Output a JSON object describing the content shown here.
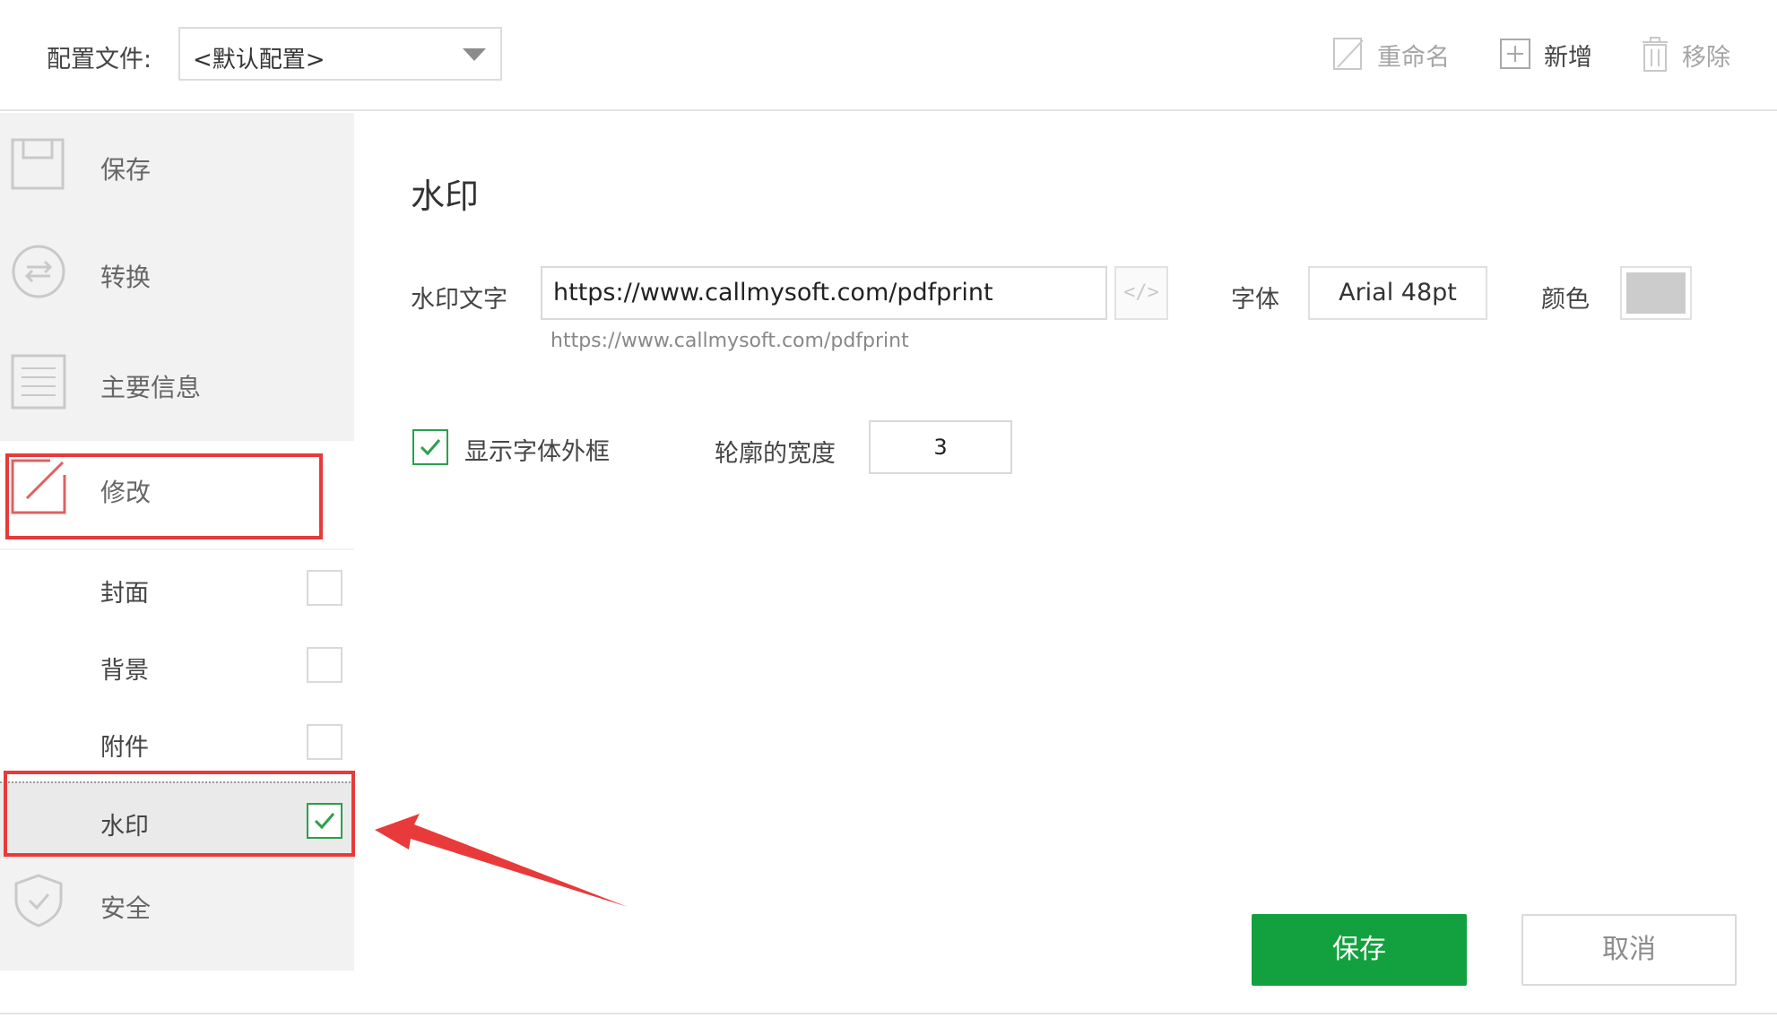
{
  "header": {
    "profile_label": "配置文件:",
    "profile_value": "<默认配置>",
    "rename_label": "重命名",
    "new_label": "新增",
    "remove_label": "移除"
  },
  "sidebar": {
    "items": [
      {
        "label": "保存",
        "icon": "save-icon"
      },
      {
        "label": "转换",
        "icon": "convert-icon"
      },
      {
        "label": "主要信息",
        "icon": "info-list-icon"
      },
      {
        "label": "修改",
        "icon": "edit-icon"
      },
      {
        "label": "安全",
        "icon": "shield-icon"
      }
    ],
    "sub_items": [
      {
        "label": "封面",
        "checked": false
      },
      {
        "label": "背景",
        "checked": false
      },
      {
        "label": "附件",
        "checked": false
      },
      {
        "label": "水印",
        "checked": true
      }
    ]
  },
  "main": {
    "title": "水印",
    "watermark_text_label": "水印文字",
    "watermark_text_value": "https://www.callmysoft.com/pdfprint",
    "watermark_preview": "https://www.callmysoft.com/pdfprint",
    "code_button_label": "</>",
    "font_label": "字体",
    "font_value": "Arial 48pt",
    "color_label": "颜色",
    "color_value": "#cccccc",
    "show_outline_label": "显示字体外框",
    "show_outline_checked": true,
    "outline_width_label": "轮廓的宽度",
    "outline_width_value": "3"
  },
  "footer": {
    "save_label": "保存",
    "cancel_label": "取消"
  },
  "colors": {
    "accent_green": "#13a03e",
    "highlight_red": "#e83a3a",
    "sidebar_bg": "#f2f2f2"
  }
}
